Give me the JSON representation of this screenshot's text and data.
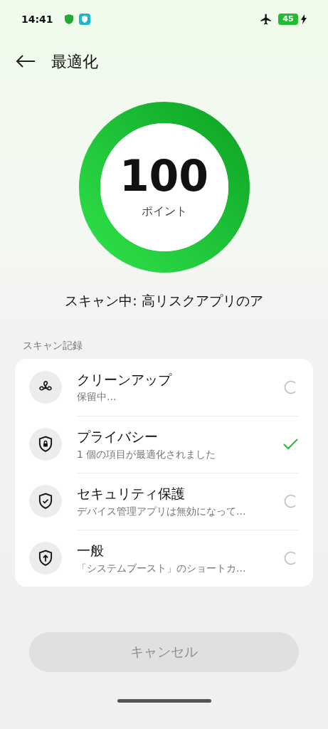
{
  "status_bar": {
    "time": "14:41",
    "battery": "45"
  },
  "header": {
    "title": "最適化"
  },
  "score": {
    "value": "100",
    "unit": "ポイント",
    "level": 1
  },
  "scan_status": "スキャン中: 高リスクアプリのア",
  "section_title": "スキャン記録",
  "items": [
    {
      "kind": "fan",
      "title": "クリーンアップ",
      "subtitle": "保留中...",
      "done": false
    },
    {
      "kind": "lock",
      "title": "プライバシー",
      "subtitle": "1 個の項目が最適化されました",
      "done": true
    },
    {
      "kind": "check",
      "title": "セキュリティ保護",
      "subtitle": "デバイス管理アプリは無効になって...",
      "done": false
    },
    {
      "kind": "up",
      "title": "一般",
      "subtitle": "「システムブースト」のショートカ...",
      "done": false
    }
  ],
  "cancel_button": {
    "label": "キャンセル",
    "disabled": true
  }
}
